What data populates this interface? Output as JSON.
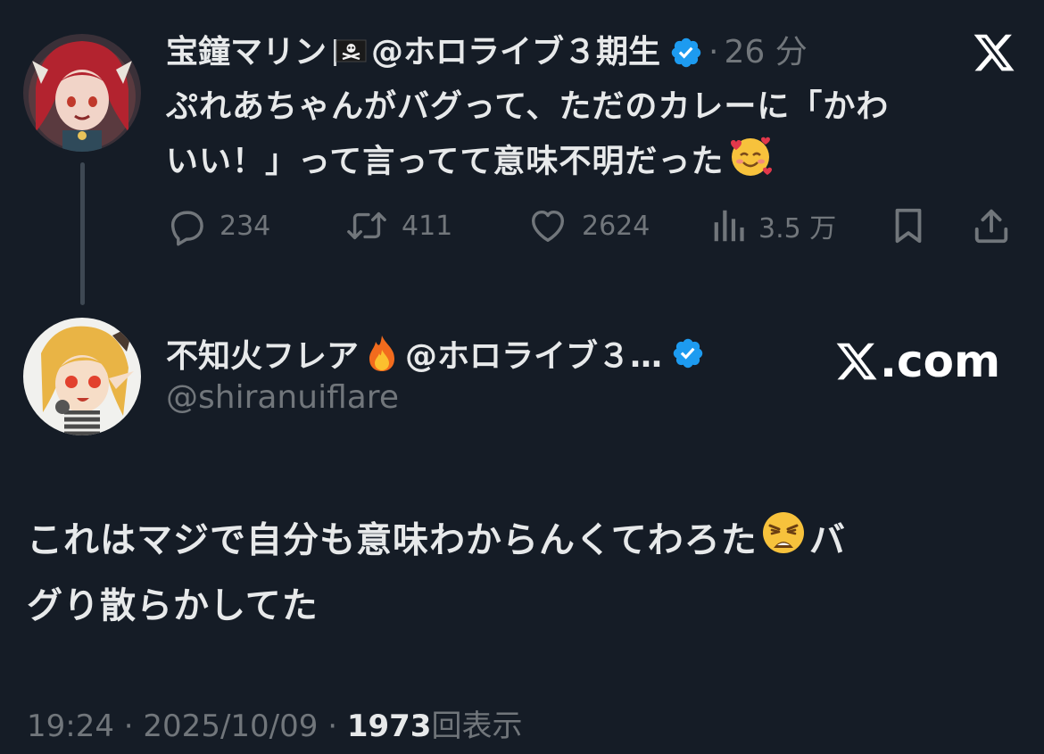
{
  "tweet1": {
    "display_name": "宝鐘マリン",
    "flag_emoji": "🏴‍☠️",
    "handle_suffix": "@ホロライブ３期生",
    "separator": "·",
    "time": "26 分",
    "text_lines": [
      "ぷれあちゃんがバグって、ただのカレーに「かわ",
      "いい！」って言ってて意味不明だった"
    ],
    "emoji": "🥰",
    "actions": {
      "reply_count": "234",
      "retweet_count": "411",
      "like_count": "2624",
      "views_count": "3.5 万"
    },
    "avatar_colors": {
      "hair": "#b3232f",
      "skin": "#f1d4c8",
      "bg": "#3a3038"
    }
  },
  "tweet2": {
    "display_name": "不知火フレア",
    "fire_emoji": "🔥",
    "handle_suffix": "@ホロライブ３…",
    "handle": "@shiranuiflare",
    "source_label": ".com",
    "text_lines": [
      "これはマジで自分も意味わからんくてわろた",
      "グり散らかしてた"
    ],
    "emoji": "😩",
    "text_line1_tail": "バ",
    "meta": {
      "time": "19:24",
      "sep1": "·",
      "date": "2025/10/09",
      "sep2": "·",
      "views": "1973",
      "views_label": "回表示"
    },
    "avatar_colors": {
      "hair": "#e9b445",
      "skin": "#f6ddc7",
      "bg": "#f1f1ee"
    }
  },
  "colors": {
    "background": "#151c26",
    "text": "#e7e9ea",
    "muted": "#71767b",
    "verified": "#1d9bf0",
    "thread_line": "#3e4853"
  },
  "icons": {
    "reply": "speech-bubble-icon",
    "retweet": "retweet-icon",
    "like": "heart-icon",
    "views": "bar-chart-icon",
    "bookmark": "bookmark-icon",
    "share": "share-upload-icon",
    "x": "x-logo-icon",
    "verified": "verified-badge-icon"
  }
}
